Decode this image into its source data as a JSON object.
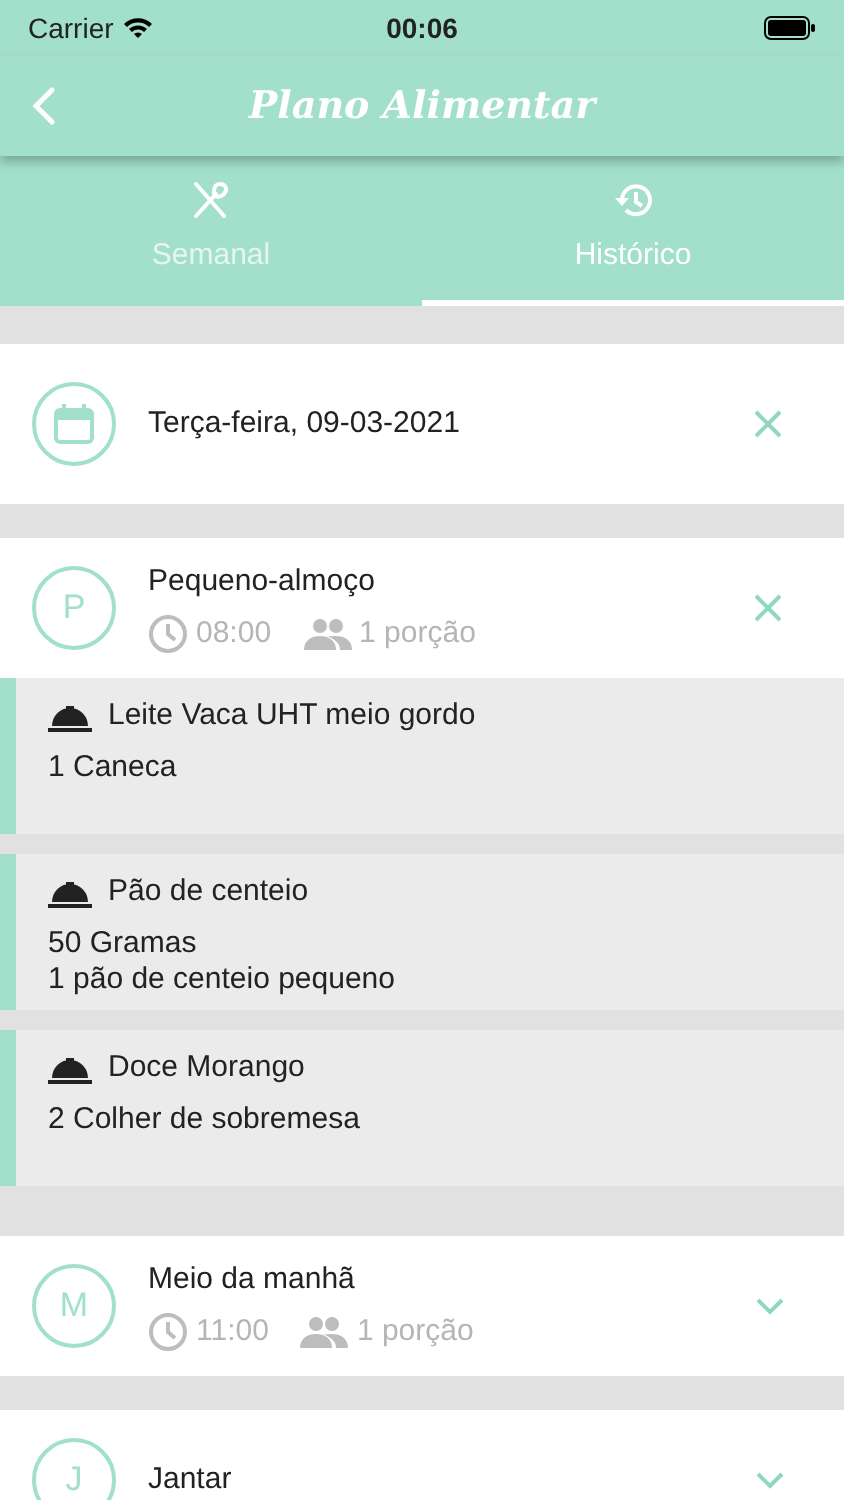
{
  "status_bar": {
    "carrier": "Carrier",
    "time": "00:06"
  },
  "header": {
    "title": "Plano Alimentar"
  },
  "tabs": [
    {
      "label": "Semanal",
      "selected": false,
      "kind": "cutlery"
    },
    {
      "label": "Histórico",
      "selected": true,
      "kind": "history"
    }
  ],
  "day": {
    "date": "Terça-feira, 09-03-2021"
  },
  "meals": [
    {
      "letter": "P",
      "name": "Pequeno-almoço",
      "time": "08:00",
      "portions": "1 porção",
      "expanded": true,
      "items": [
        {
          "name": "Leite Vaca UHT meio gordo",
          "lines": [
            "1 Caneca"
          ]
        },
        {
          "name": "Pão de centeio",
          "lines": [
            "50 Gramas",
            "1 pão de centeio pequeno"
          ]
        },
        {
          "name": "Doce Morango",
          "lines": [
            "2 Colher de sobremesa"
          ]
        }
      ]
    },
    {
      "letter": "M",
      "name": "Meio da manhã",
      "time": "11:00",
      "portions": "1 porção",
      "expanded": false
    },
    {
      "letter": "J",
      "name": "Jantar",
      "expanded": false
    }
  ]
}
